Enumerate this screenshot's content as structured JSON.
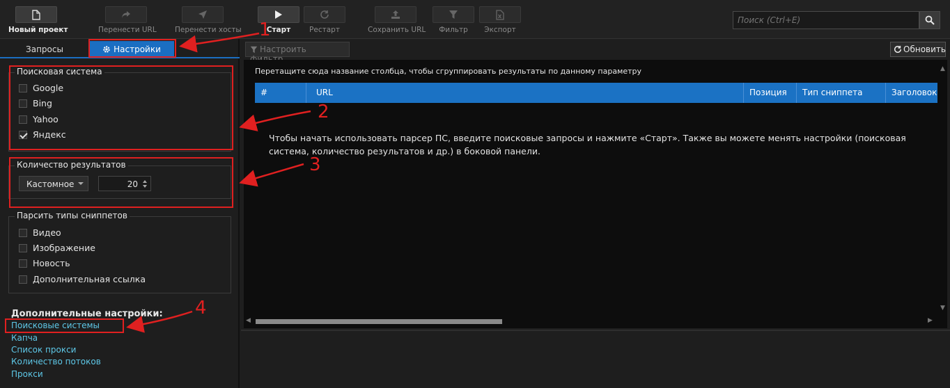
{
  "toolbar": {
    "buttons": [
      {
        "label": "Новый проект",
        "icon": "file-icon",
        "state": "active"
      },
      {
        "label": "Перенести URL",
        "icon": "share-arrow-icon",
        "state": "disabled"
      },
      {
        "label": "Перенести хосты",
        "icon": "send-icon",
        "state": "disabled"
      },
      {
        "label": "Старт",
        "icon": "play-icon",
        "state": "active"
      },
      {
        "label": "Рестарт",
        "icon": "refresh-icon",
        "state": "disabled"
      },
      {
        "label": "Сохранить URL",
        "icon": "upload-icon",
        "state": "disabled"
      },
      {
        "label": "Фильтр",
        "icon": "funnel-icon",
        "state": "disabled"
      },
      {
        "label": "Экспорт",
        "icon": "excel-icon",
        "state": "disabled"
      }
    ],
    "search": {
      "placeholder": "Поиск (Ctrl+E)",
      "icon": "search-icon"
    }
  },
  "left_panel": {
    "tabs": [
      {
        "label": "Запросы",
        "selected": false
      },
      {
        "label": "Настройки",
        "selected": true,
        "icon": "gear-icon"
      }
    ],
    "search_engine": {
      "title": "Поисковая система",
      "options": [
        {
          "label": "Google",
          "checked": false
        },
        {
          "label": "Bing",
          "checked": false
        },
        {
          "label": "Yahoo",
          "checked": false
        },
        {
          "label": "Яндекс",
          "checked": true
        }
      ]
    },
    "results_count": {
      "title": "Количество результатов",
      "mode": "Кастомное",
      "value": "20"
    },
    "snippet_types": {
      "title": "Парсить типы сниппетов",
      "options": [
        {
          "label": "Видео",
          "checked": false
        },
        {
          "label": "Изображение",
          "checked": false
        },
        {
          "label": "Новость",
          "checked": false
        },
        {
          "label": "Дополнительная ссылка",
          "checked": false
        }
      ]
    },
    "advanced": {
      "title": "Дополнительные настройки:",
      "links": [
        "Поисковые системы",
        "Капча",
        "Список прокси",
        "Количество потоков",
        "Прокси"
      ]
    }
  },
  "right_panel": {
    "filter_button": "Настроить фильтр...",
    "refresh_button": "Обновить",
    "group_hint": "Перетащите сюда название столбца, чтобы сгруппировать результаты по данному параметру",
    "columns": [
      "#",
      "URL",
      "Позиция",
      "Тип сниппета",
      "Заголовок"
    ],
    "empty_message": "Чтобы начать использовать парсер ПС, введите поисковые запросы и нажмите «Старт». Также вы можете менять настройки (поисковая система, количество результатов и др.) в боковой панели."
  },
  "annotations": [
    "1",
    "2",
    "3",
    "4"
  ],
  "colors": {
    "accent": "#1b6ec2",
    "annotation": "#e02020",
    "link": "#5ec8e8"
  }
}
